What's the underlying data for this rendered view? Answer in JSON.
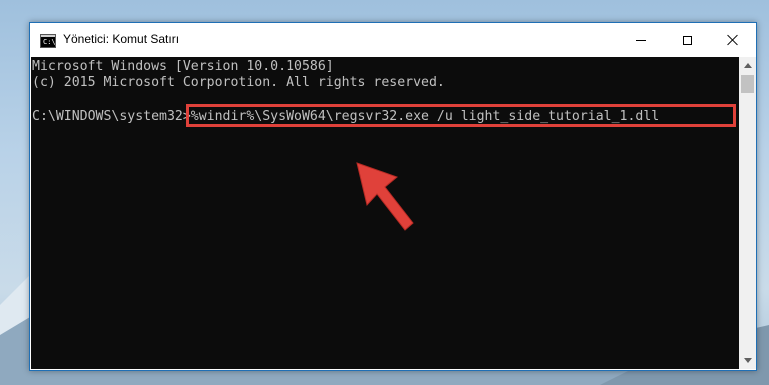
{
  "window": {
    "title": "Yönetici: Komut Satırı",
    "icon_text": "C:\\_"
  },
  "console": {
    "lines": [
      "Microsoft Windows [Version 10.0.10586]",
      "(c) 2015 Microsoft Corporotion. All rights reserved.",
      "C:\\WINDOWS\\system32>%windir%\\SysWoW64\\regsvr32.exe /u light_side_tutorial_1.dll"
    ]
  },
  "colors": {
    "console_bg": "#0c0c0c",
    "console_text": "#c0c0c0",
    "highlight": "#e0413a",
    "window_border": "#1f6fb5"
  },
  "icons": {
    "minimize": "minimize-icon",
    "maximize": "maximize-icon",
    "close": "close-icon",
    "arrow": "red-arrow-icon"
  }
}
